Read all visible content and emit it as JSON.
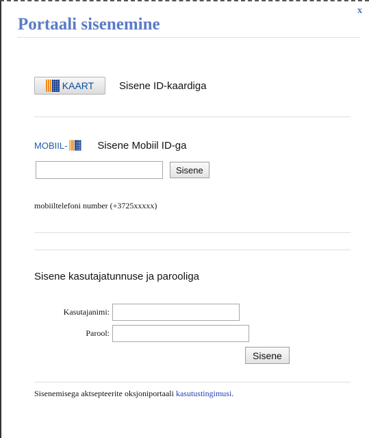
{
  "modal": {
    "title": "Portaali sisenemine",
    "close_label": "x"
  },
  "id_card": {
    "badge_text": "KAART",
    "label": "Sisene ID-kaardiga"
  },
  "mobile_id": {
    "logo_text": "MOBIIL-",
    "label": "Sisene Mobiil ID-ga",
    "phone_value": "",
    "submit_label": "Sisene",
    "hint": "mobiiltelefoni number (+3725xxxxx)"
  },
  "password_login": {
    "heading": "Sisene kasutajatunnuse ja parooliga",
    "username_label": "Kasutajanimi:",
    "username_value": "",
    "password_label": "Parool:",
    "password_value": "",
    "submit_label": "Sisene"
  },
  "footer": {
    "text": "Sisenemisega aktsepteerite oksjoniportaali",
    "link_text": "kasutustingimusi",
    "trailing": "."
  },
  "colors": {
    "title": "#5a7bc7",
    "link": "#1a3fb3",
    "id_blue": "#1f5cab",
    "id_orange": "#f28a1b"
  }
}
